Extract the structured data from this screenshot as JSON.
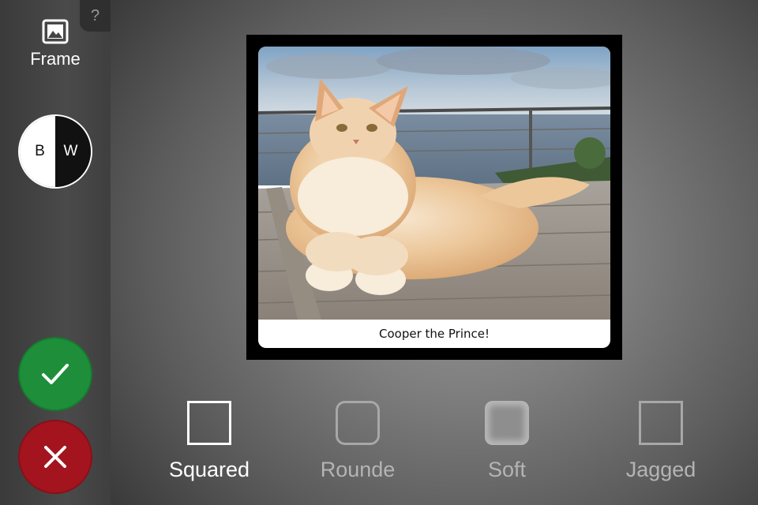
{
  "help": {
    "label": "?"
  },
  "tools": {
    "frame": {
      "label": "Frame",
      "icon": "image-icon"
    },
    "bw_toggle": {
      "left": "B",
      "right": "W"
    }
  },
  "actions": {
    "confirm_icon": "checkmark-icon",
    "cancel_icon": "close-icon",
    "confirm_color": "#1e8e3a",
    "cancel_color": "#a3141f"
  },
  "photo": {
    "caption": "Cooper the Prince!",
    "subject": "cat-photo"
  },
  "frame_styles": [
    {
      "label": "Squared",
      "selected": true
    },
    {
      "label": "Rounde",
      "selected": false
    },
    {
      "label": "Soft",
      "selected": false
    },
    {
      "label": "Jagged",
      "selected": false
    }
  ]
}
